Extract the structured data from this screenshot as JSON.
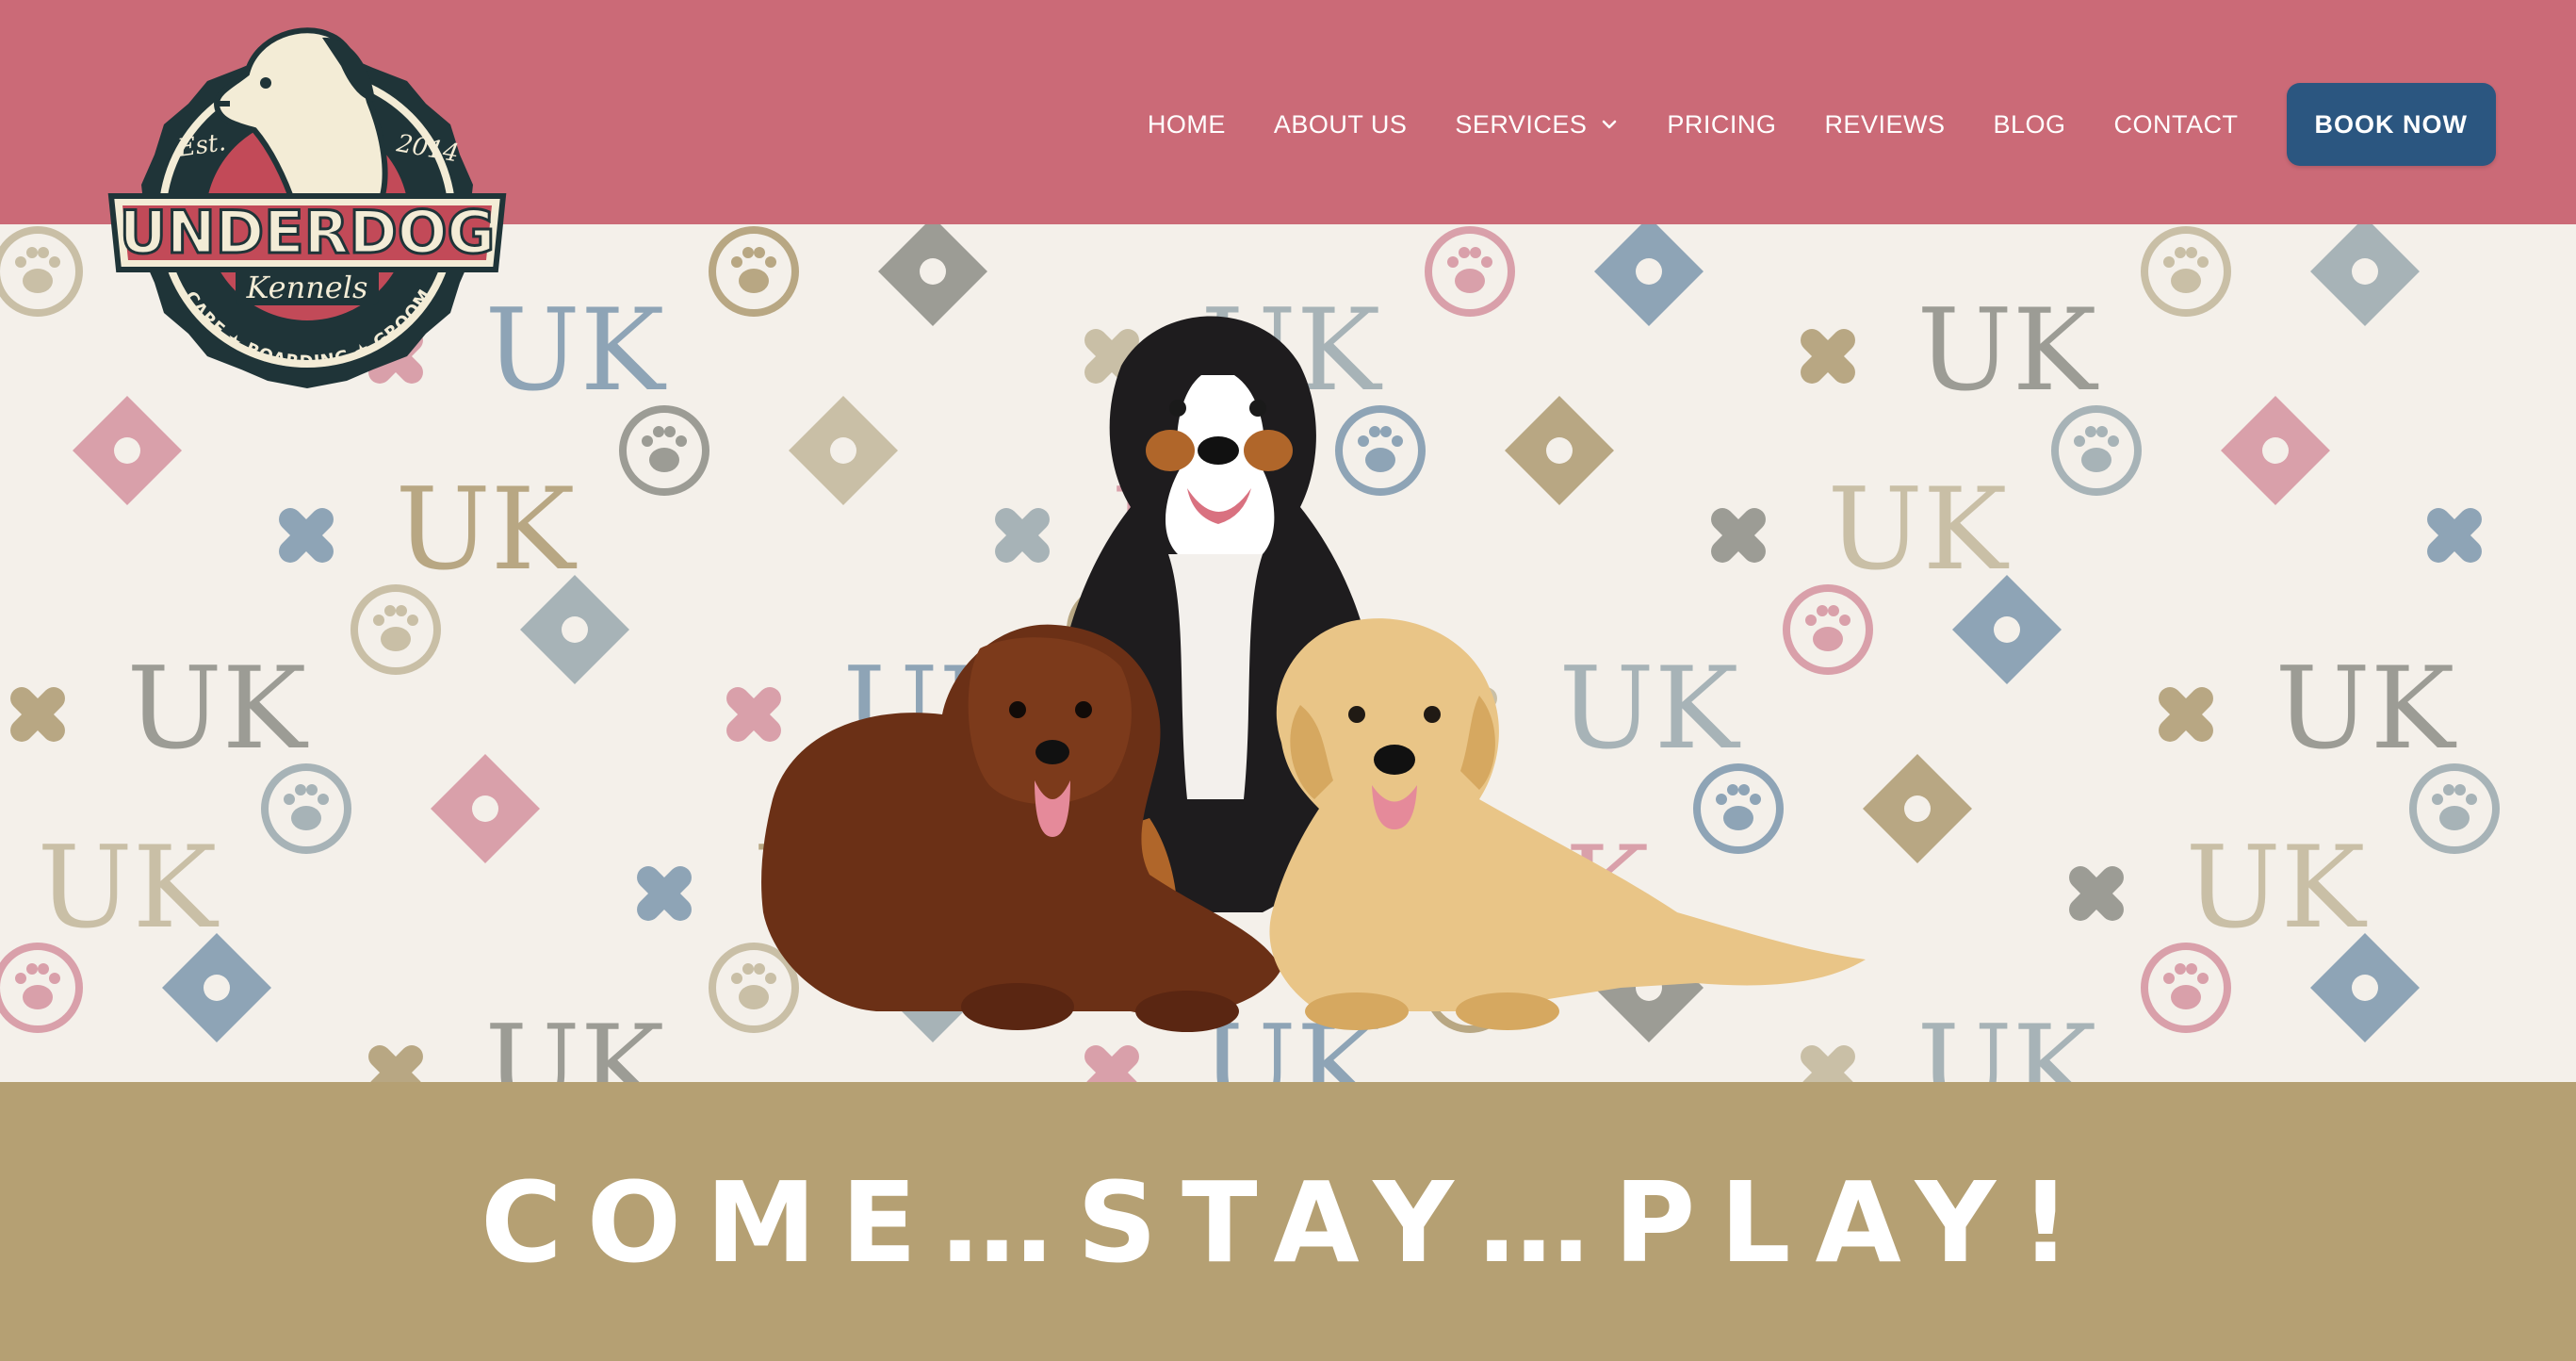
{
  "brand": {
    "name": "UNDERDOG",
    "sub": "Kennels",
    "established_left": "Est.",
    "established_right": "2014",
    "services_ring": "DAYCARE ★ BOARDING ★ GROOMING"
  },
  "nav": {
    "items": [
      {
        "label": "HOME"
      },
      {
        "label": "ABOUT US"
      },
      {
        "label": "SERVICES"
      },
      {
        "label": "PRICING"
      },
      {
        "label": "REVIEWS"
      },
      {
        "label": "BLOG"
      },
      {
        "label": "CONTACT"
      }
    ],
    "book_button": "BOOK NOW"
  },
  "hero": {
    "pattern_monogram": "UK",
    "tagline": "COME…STAY…PLAY!"
  },
  "colors": {
    "header": "#cb6a77",
    "button": "#2b5680",
    "band": "#b5a073",
    "hero_bg": "#f4f0ea"
  }
}
